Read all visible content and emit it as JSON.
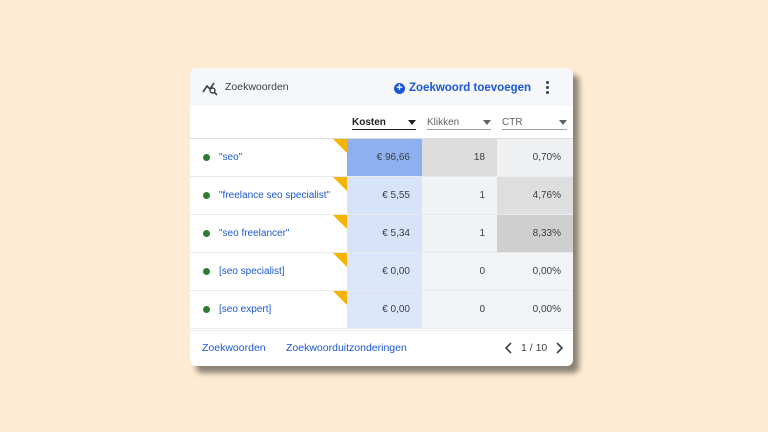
{
  "header": {
    "title": "Zoekwoorden",
    "add_label": "Zoekwoord toevoegen",
    "add_icon": "plus-circle-icon",
    "more_icon": "more-vert-icon",
    "title_icon": "keyword-search-icon"
  },
  "columns": [
    {
      "label": "Kosten",
      "active": true
    },
    {
      "label": "Klikken",
      "active": false
    },
    {
      "label": "CTR",
      "active": false
    }
  ],
  "rows": [
    {
      "keyword": "\"seo\"",
      "kosten": "€ 96,66",
      "klikken": "18",
      "ctr": "0,70%",
      "kosten_level": 1.0,
      "klikken_level": 1.0,
      "ctr_level": 0.08
    },
    {
      "keyword": "\"freelance seo specialist\"",
      "kosten": "€ 5,55",
      "klikken": "1",
      "ctr": "4,76%",
      "kosten_level": 0.06,
      "klikken_level": 0.06,
      "ctr_level": 0.57
    },
    {
      "keyword": "\"seo freelancer\"",
      "kosten": "€ 5,34",
      "klikken": "1",
      "ctr": "8,33%",
      "kosten_level": 0.055,
      "klikken_level": 0.06,
      "ctr_level": 1.0
    },
    {
      "keyword": "[seo specialist]",
      "kosten": "€ 0,00",
      "klikken": "0",
      "ctr": "0,00%",
      "kosten_level": 0,
      "klikken_level": 0,
      "ctr_level": 0
    },
    {
      "keyword": "[seo expert]",
      "kosten": "€ 0,00",
      "klikken": "0",
      "ctr": "0,00%",
      "kosten_level": 0,
      "klikken_level": 0,
      "ctr_level": 0
    }
  ],
  "footer": {
    "link1": "Zoekwoorden",
    "link2": "Zoekwoorduitzonderingen",
    "page": "1 / 10"
  },
  "colors": {
    "accent": "#1a57d6",
    "status_dot": "#2e7d32",
    "flag": "#f4b400",
    "kosten_low": "#dbe6fa",
    "kosten_high": "#8fb0ee",
    "gray_low": "#f1f3f4",
    "gray_high": "#dcdcdc"
  }
}
